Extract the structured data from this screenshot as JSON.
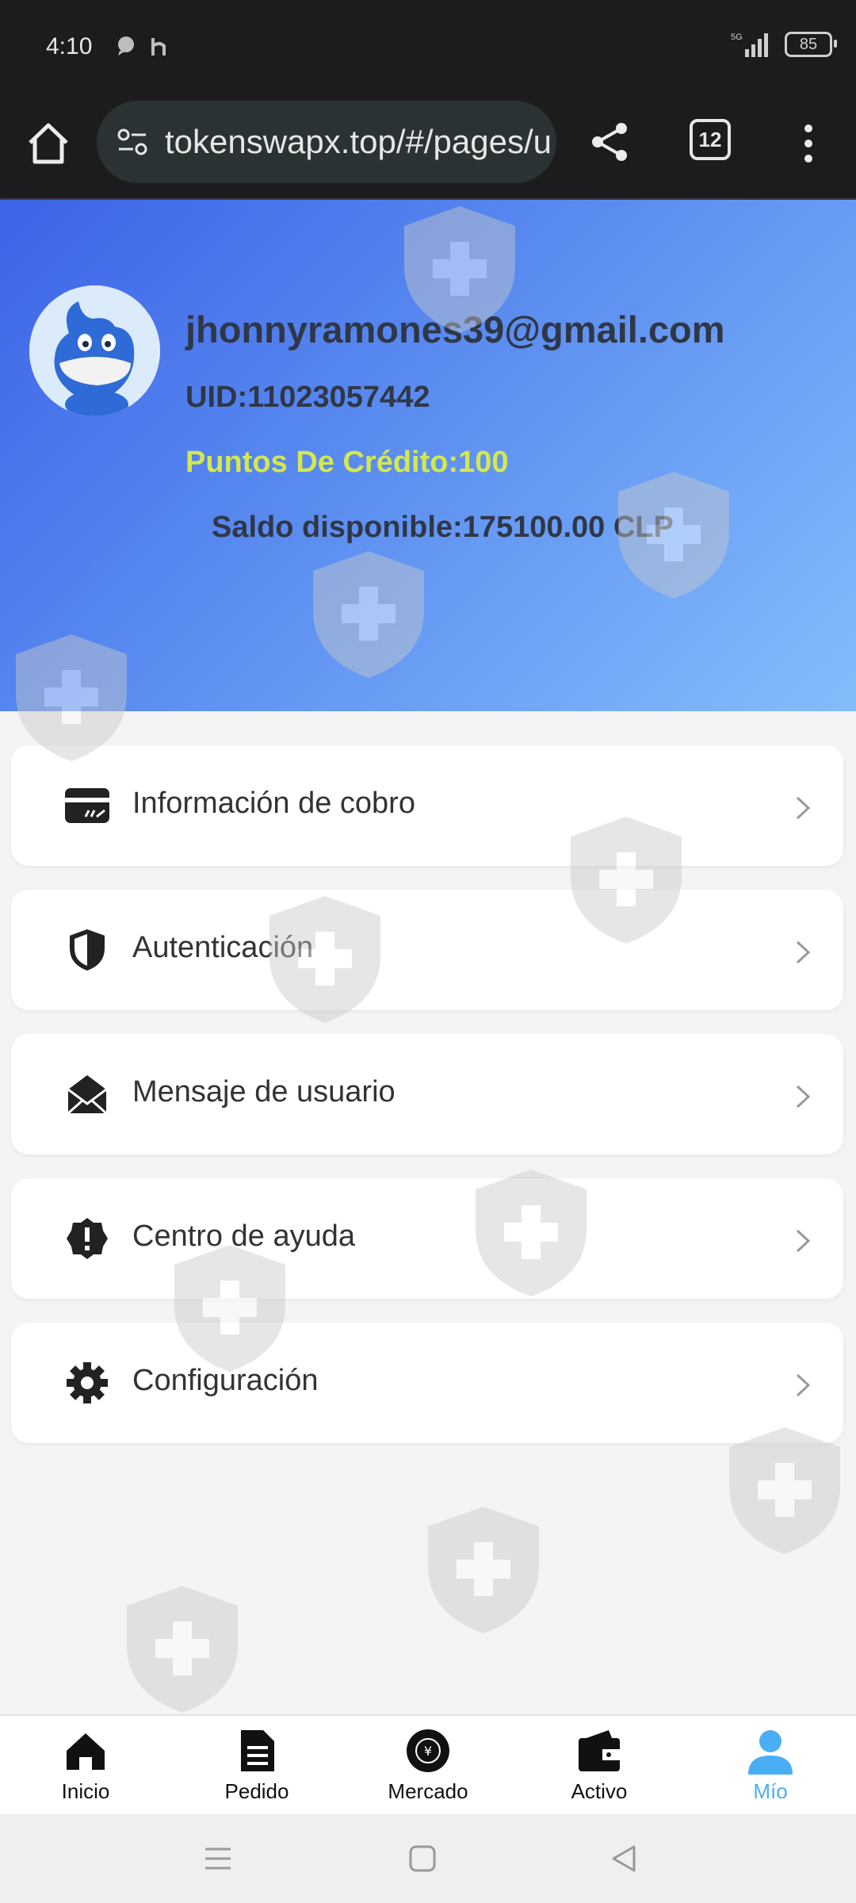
{
  "status_bar": {
    "time": "4:10",
    "network": "5G",
    "battery": "85"
  },
  "browser": {
    "url": "tokenswapx.top/#/pages/u",
    "tab_count": "12"
  },
  "profile": {
    "email": "jhonnyramones39@gmail.com",
    "uid": "UID:11023057442",
    "credit": "Puntos De Crédito:100",
    "balance": "Saldo disponible:175100.00 CLP"
  },
  "menu": {
    "items": [
      {
        "label": "Información de cobro",
        "icon": "card-icon"
      },
      {
        "label": "Autenticación",
        "icon": "shield-icon"
      },
      {
        "label": "Mensaje de usuario",
        "icon": "envelope-icon"
      },
      {
        "label": "Centro de ayuda",
        "icon": "help-badge-icon"
      },
      {
        "label": "Configuración",
        "icon": "gear-icon"
      }
    ]
  },
  "nav": {
    "items": [
      {
        "label": "Inicio",
        "icon": "home-icon"
      },
      {
        "label": "Pedido",
        "icon": "document-icon"
      },
      {
        "label": "Mercado",
        "icon": "market-icon"
      },
      {
        "label": "Activo",
        "icon": "wallet-icon"
      },
      {
        "label": "Mío",
        "icon": "user-icon"
      }
    ],
    "active_color": "#4aaef5"
  },
  "colors": {
    "hero_start": "#3d63e8",
    "hero_end": "#84bdfb",
    "credit": "#d4e84e"
  }
}
